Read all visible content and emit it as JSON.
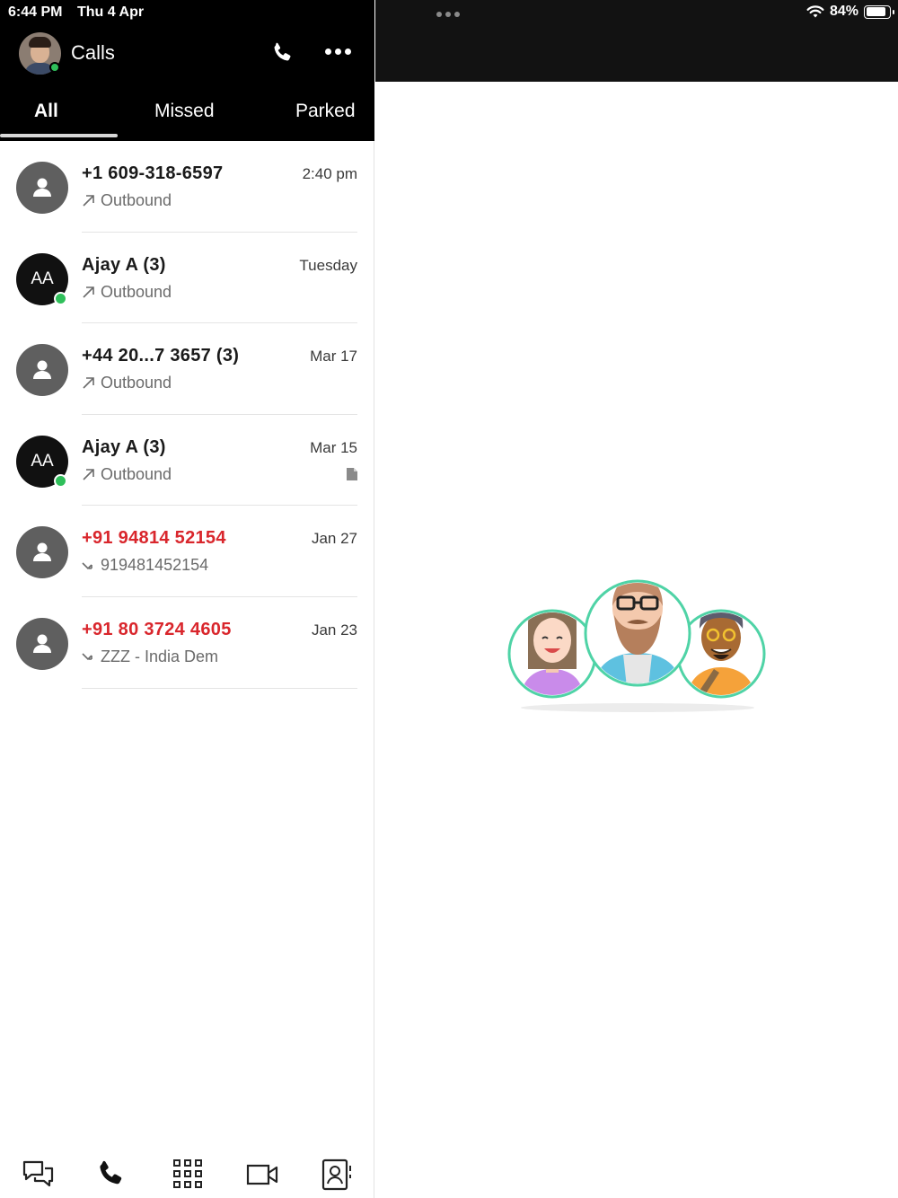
{
  "status_bar": {
    "time": "6:44 PM",
    "date": "Thu 4 Apr",
    "battery_pct": "84%",
    "battery_level": 0.84
  },
  "header": {
    "title": "Calls"
  },
  "tabs": [
    {
      "label": "All",
      "active": true
    },
    {
      "label": "Missed",
      "active": false
    },
    {
      "label": "Parked",
      "active": false
    }
  ],
  "calls": [
    {
      "name": "+1 609-318-6597",
      "detail": "Outbound",
      "when": "2:40 pm",
      "avatar": "person",
      "missed": false
    },
    {
      "name": "Ajay A (3)",
      "detail": "Outbound",
      "when": "Tuesday",
      "avatar": "initials",
      "initials": "AA",
      "online": true,
      "missed": false
    },
    {
      "name": "+44 20...7 3657 (3)",
      "detail": "Outbound",
      "when": "Mar 17",
      "avatar": "person",
      "missed": false
    },
    {
      "name": "Ajay A (3)",
      "detail": "Outbound",
      "when": "Mar 15",
      "avatar": "initials",
      "initials": "AA",
      "online": true,
      "missed": false,
      "has_note": true
    },
    {
      "name": "+91 94814 52154",
      "detail": "919481452154",
      "when": "Jan 27",
      "avatar": "person",
      "missed": true
    },
    {
      "name": "+91 80 3724 4605",
      "detail": "ZZZ - India Dem",
      "when": "Jan 23",
      "avatar": "person",
      "missed": true
    }
  ],
  "bottom_nav": [
    "messages-icon",
    "phone-icon",
    "dialpad-icon",
    "video-icon",
    "contacts-icon"
  ],
  "colors": {
    "accent_missed": "#d9262c",
    "online": "#2fbf5a",
    "header_bg": "#000000"
  }
}
